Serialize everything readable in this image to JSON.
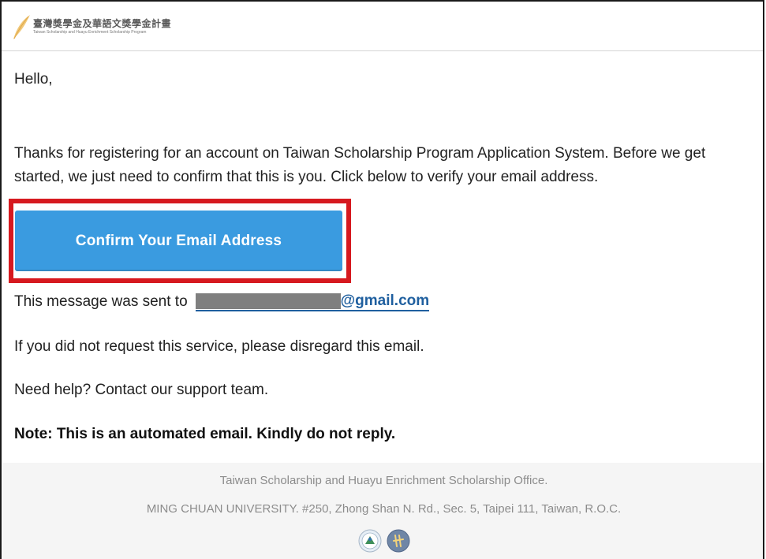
{
  "header": {
    "logo_zh": "臺灣獎學金及華語文獎學金計畫",
    "logo_en": "Taiwan Scholarship and Huayu Enrichment Scholarship Program"
  },
  "body": {
    "greeting": "Hello,",
    "intro": "Thanks for registering for an account on Taiwan Scholarship Program Application System. Before we get started, we just need to confirm that this is you. Click below to verify your email address.",
    "confirm_button": "Confirm Your Email Address",
    "sent_to_prefix": "This message was sent to",
    "email_domain": "@gmail.com",
    "disregard": "If you did not request this service, please disregard this email.",
    "help": "Need help? Contact our support team.",
    "note": "Note: This is an automated email. Kindly do not reply."
  },
  "footer": {
    "office": "Taiwan Scholarship and Huayu Enrichment Scholarship Office.",
    "address": "MING CHUAN UNIVERSITY. #250, Zhong Shan N. Rd., Sec. 5, Taipei 111, Taiwan, R.O.C."
  },
  "colors": {
    "button": "#3a9be0",
    "highlight": "#d6191f",
    "link": "#1f5f9f",
    "footer_bg": "#f5f5f5"
  },
  "icons": {
    "logo": "feather-icon",
    "seal_left": "ministry-seal-icon",
    "seal_right": "moe-seal-icon"
  }
}
